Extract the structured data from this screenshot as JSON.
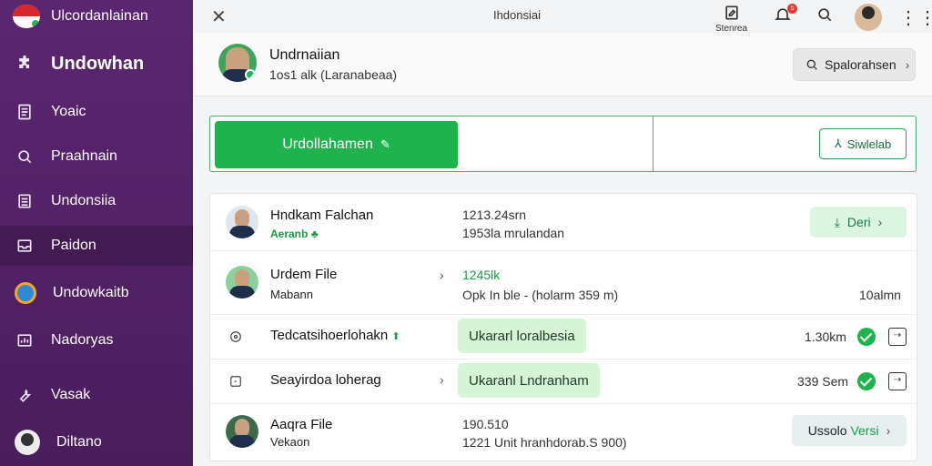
{
  "sidebar": {
    "brand": "Ulcordanlainan",
    "items": [
      {
        "label": "Undowhan",
        "icon": "puzzle-icon"
      },
      {
        "label": "Yoaic",
        "icon": "document-icon"
      },
      {
        "label": "Praahnain",
        "icon": "search-icon"
      },
      {
        "label": "Undonsiia",
        "icon": "list-icon"
      },
      {
        "label": "Paidon",
        "icon": "inbox-icon"
      },
      {
        "label": "Undowkaitb",
        "icon": "globe-icon"
      },
      {
        "label": "Nadoryas",
        "icon": "chart-icon"
      },
      {
        "label": "Vasak",
        "icon": "wrench-icon"
      },
      {
        "label": "Diltano",
        "icon": "avatar-icon"
      }
    ]
  },
  "topbar": {
    "title": "Ihdonsiai",
    "storage_label": "Stenrea"
  },
  "profile": {
    "name": "Undrnaiian",
    "subtitle": "1os1 alk (Laranabeaa)",
    "button_label": "Spalorahsen"
  },
  "actions": {
    "primary_label": "Urdollahamen",
    "secondary_label": "Siwlelab"
  },
  "rows": [
    {
      "title": "Hndkam Falchan",
      "sub": "Aeranb",
      "col2_line1": "1213.24srn",
      "col2_line2": "1953la mrulandan",
      "button": "Deri"
    },
    {
      "title": "Urdem File",
      "sub": "Mabann",
      "col2_line1": "1245lk",
      "col2_line2": "Opk In ble - (holarm 359 m)",
      "right": "10almn"
    },
    {
      "title": "Tedcatsihoerlohakn",
      "pill": "Ukararl loralbesia",
      "right": "1.30km"
    },
    {
      "title": "Seayirdoa loherag",
      "pill": "Ukaranl Lndranham",
      "right": "339 Sem"
    },
    {
      "title": "Aaqra File",
      "sub": "Vekaon",
      "col2_line1": "190.510",
      "col2_line2": "1221 Unit hranhdorab.S 900)",
      "button_a": "Ussolo",
      "button_b": "Versi"
    }
  ]
}
